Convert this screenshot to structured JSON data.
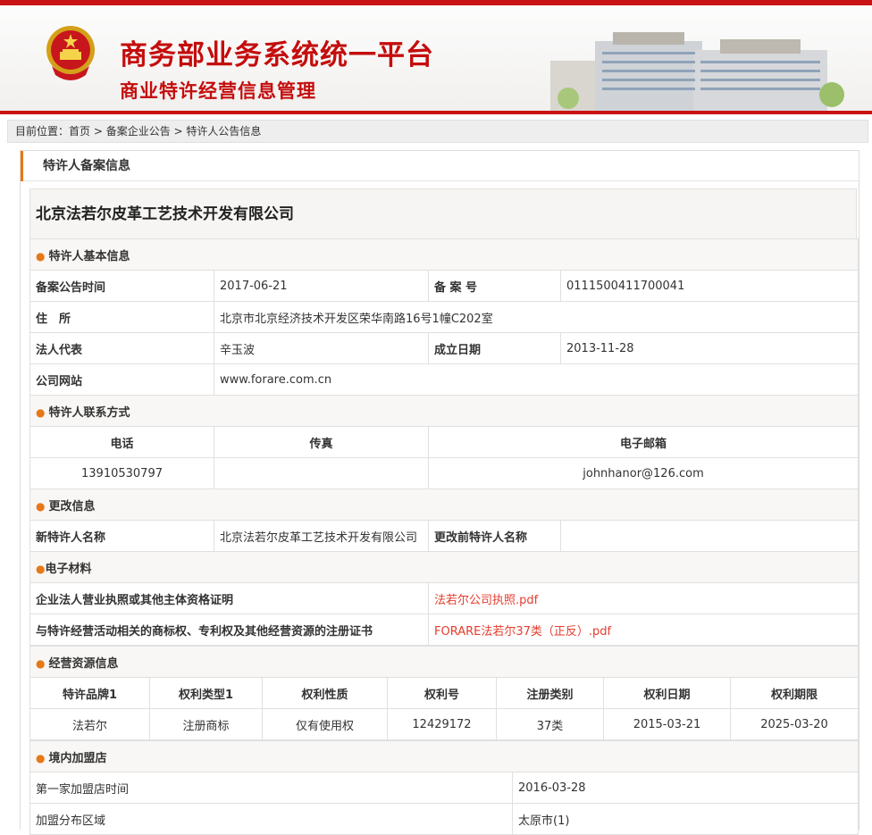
{
  "banner": {
    "title": "商务部业务系统统一平台",
    "subtitle": "商业特许经营信息管理"
  },
  "breadcrumb": {
    "prefix": "目前位置：",
    "home": "首页",
    "sep": " > ",
    "level2": "备案企业公告",
    "current": "特许人公告信息"
  },
  "panel": {
    "title": "特许人备案信息",
    "company": "北京法若尔皮革工艺技术开发有限公司"
  },
  "basic": {
    "section": "特许人基本信息",
    "date_label": "备案公告时间",
    "date_value": "2017-06-21",
    "record_label": "备 案 号",
    "record_value": "0111500411700041",
    "address_label": "住　所",
    "address_value": "北京市北京经济技术开发区荣华南路16号1幢C202室",
    "legal_label": "法人代表",
    "legal_value": "辛玉波",
    "founded_label": "成立日期",
    "founded_value": "2013-11-28",
    "website_label": "公司网站",
    "website_value": "www.forare.com.cn"
  },
  "contact": {
    "section": "特许人联系方式",
    "phone_label": "电话",
    "fax_label": "传真",
    "email_label": "电子邮箱",
    "phone_value": "13910530797",
    "fax_value": "",
    "email_value": "johnhanor@126.com"
  },
  "change": {
    "section": "更改信息",
    "new_label": "新特许人名称",
    "new_value": "北京法若尔皮革工艺技术开发有限公司",
    "old_label": "更改前特许人名称",
    "old_value": ""
  },
  "materials": {
    "section": "电子材料",
    "license_label": "企业法人营业执照或其他主体资格证明",
    "license_file": "法若尔公司执照.pdf",
    "cert_label": "与特许经营活动相关的商标权、专利权及其他经营资源的注册证书",
    "cert_file": "FORARE法若尔37类（正反）.pdf"
  },
  "resources": {
    "section": "经营资源信息",
    "headers": [
      "特许品牌1",
      "权利类型1",
      "权利性质",
      "权利号",
      "注册类别",
      "权利日期",
      "权利期限"
    ],
    "row": [
      "法若尔",
      "注册商标",
      "仅有使用权",
      "12429172",
      "37类",
      "2015-03-21",
      "2025-03-20"
    ]
  },
  "stores": {
    "section": "境内加盟店",
    "first_label": "第一家加盟店时间",
    "first_value": "2016-03-28",
    "region_label": "加盟分布区域",
    "region_value": "太原市(1)"
  },
  "colors": {
    "brand_red": "#c40d0d",
    "accent_orange": "#e67817",
    "link_red": "#e53b2c"
  }
}
